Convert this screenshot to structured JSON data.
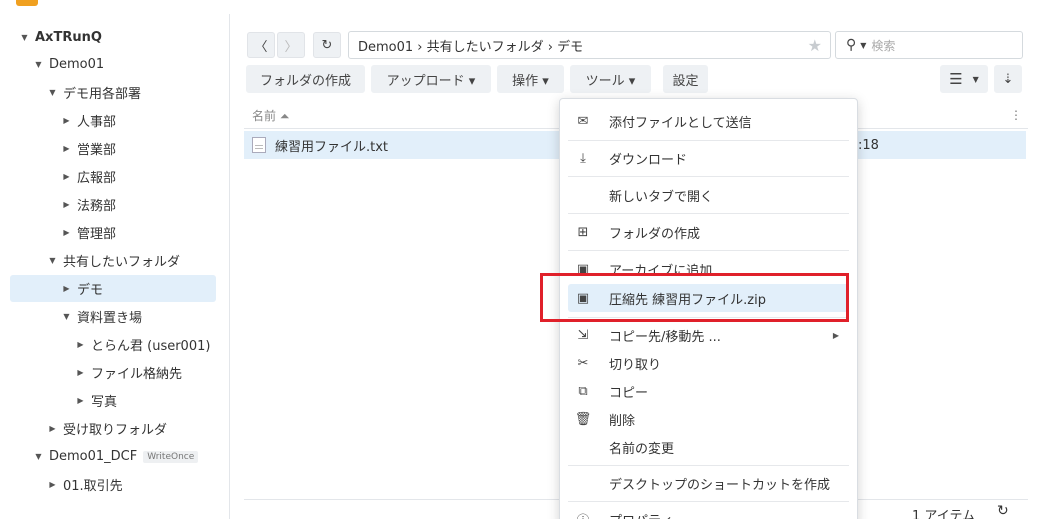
{
  "sidebar": {
    "items": [
      {
        "label": "AxTRunQ",
        "caret": "▼",
        "bold": true
      },
      {
        "label": "Demo01",
        "caret": "▼"
      },
      {
        "label": "デモ用各部署",
        "caret": "▼"
      },
      {
        "label": "人事部",
        "caret": "▶"
      },
      {
        "label": "営業部",
        "caret": "▶"
      },
      {
        "label": "広報部",
        "caret": "▶"
      },
      {
        "label": "法務部",
        "caret": "▶"
      },
      {
        "label": "管理部",
        "caret": "▶"
      },
      {
        "label": "共有したいフォルダ",
        "caret": "▼"
      },
      {
        "label": "デモ",
        "caret": "▶",
        "selected": true
      },
      {
        "label": "資料置き場",
        "caret": "▼"
      },
      {
        "label": "とらん君 (user001)",
        "caret": "▶"
      },
      {
        "label": "ファイル格納先",
        "caret": "▶"
      },
      {
        "label": "写真",
        "caret": "▶"
      },
      {
        "label": "受け取りフォルダ",
        "caret": "▶"
      },
      {
        "label": "Demo01_DCF",
        "caret": "▼",
        "badge": "WriteOnce"
      },
      {
        "label": "01.取引先",
        "caret": "▶"
      }
    ]
  },
  "toolbar": {
    "back": "〈",
    "forward": "〉",
    "refresh": "↻",
    "path": "Demo01 › 共有したいフォルダ › デモ",
    "search_placeholder": "検索",
    "buttons": [
      "フォルダの作成",
      "アップロード ▾",
      "操作 ▾",
      "ツール ▾",
      "設定"
    ]
  },
  "list": {
    "header_name": "名前 ⏶",
    "file_name": "練習用ファイル.txt",
    "file_time_fragment": ":18",
    "item_count": "1 アイテム"
  },
  "menu": {
    "items": [
      {
        "icon": "mail-icon",
        "glyph": "✉",
        "label": "添付ファイルとして送信"
      },
      {
        "icon": "download-icon",
        "glyph": "⤓",
        "label": "ダウンロード"
      },
      {
        "icon": "",
        "glyph": "",
        "label": "新しいタブで開く"
      },
      {
        "icon": "folder-plus-icon",
        "glyph": "⊞",
        "label": "フォルダの作成"
      },
      {
        "icon": "archive-icon",
        "glyph": "▣",
        "label": "アーカイブに追加"
      },
      {
        "icon": "compress-icon",
        "glyph": "▣",
        "label": "圧縮先 練習用ファイル.zip",
        "highlight": true
      },
      {
        "icon": "copy-move-icon",
        "glyph": "⇲",
        "label": "コピー先/移動先 ...",
        "submenu": true
      },
      {
        "icon": "scissors-icon",
        "glyph": "✂",
        "label": "切り取り"
      },
      {
        "icon": "copy-icon",
        "glyph": "⧉",
        "label": "コピー"
      },
      {
        "icon": "trash-icon",
        "glyph": "🗑",
        "label": "削除"
      },
      {
        "icon": "",
        "glyph": "",
        "label": "名前の変更"
      },
      {
        "icon": "",
        "glyph": "",
        "label": "デスクトップのショートカットを作成"
      },
      {
        "icon": "info-icon",
        "glyph": "ⓘ",
        "label": "プロパティ"
      }
    ]
  },
  "colors": {
    "selection": "#e2effa",
    "highlight_box": "#e0202a"
  }
}
